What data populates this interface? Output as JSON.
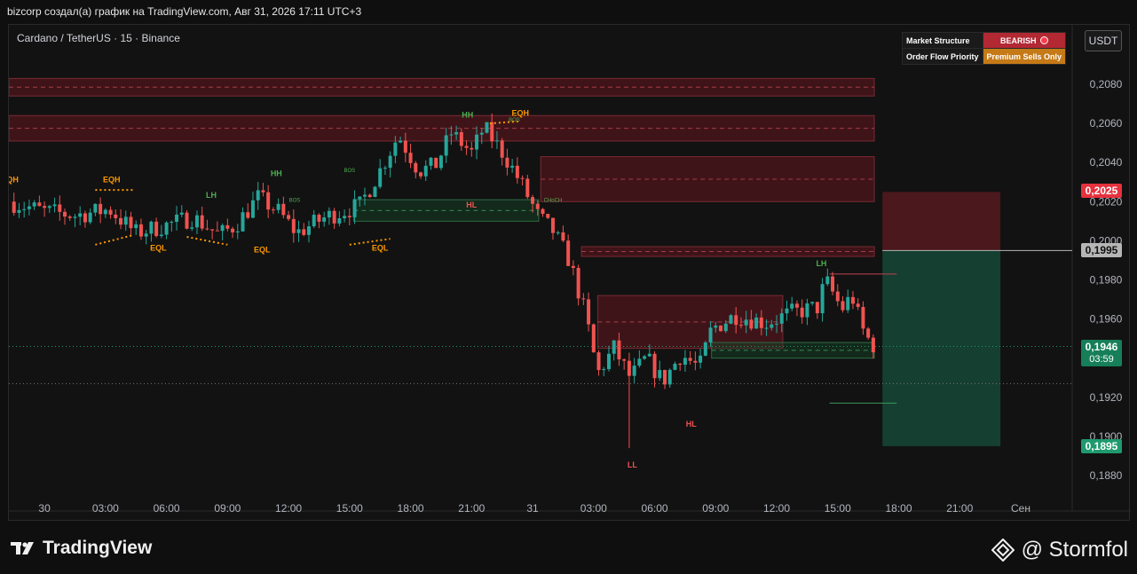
{
  "caption": "bizcorp создал(а) график на TradingView.com, Авг 31, 2026 17:11 UTC+3",
  "symbol_title": "Cardano / TetherUS · 15 · Binance",
  "status_panel": {
    "market_structure_label": "Market Structure",
    "market_structure_value": "BEARISH",
    "order_flow_label": "Order Flow Priority",
    "order_flow_value": "Premium Sells Only"
  },
  "currency_button": "USDT",
  "price_tags": {
    "red": "0,2025",
    "grey": "0,1995",
    "current": "0,1946",
    "countdown": "03:59",
    "green": "0,1895"
  },
  "footer": {
    "brand": "TradingView",
    "author": "@ Stormfol"
  },
  "colors": {
    "bull": "#26a69a",
    "bear": "#ef5350",
    "premium_zone": "#5c1a20",
    "discount_zone": "#123322",
    "label_orange": "#ff9800"
  },
  "chart_data": {
    "type": "candlestick",
    "title": "",
    "xlabel": "",
    "ylabel": "",
    "ylim": [
      0.187,
      0.21
    ],
    "y_ticks": [
      "0,2080",
      "0,2060",
      "0,2040",
      "0,2020",
      "0,2000",
      "0,1980",
      "0,1960",
      "0,1940",
      "0,1920",
      "0,1900",
      "0,1880"
    ],
    "y_tick_values": [
      0.208,
      0.206,
      0.204,
      0.202,
      0.2,
      0.198,
      0.196,
      0.194,
      0.192,
      0.19,
      0.188
    ],
    "x_ticks": [
      "30",
      "03:00",
      "06:00",
      "09:00",
      "12:00",
      "15:00",
      "18:00",
      "21:00",
      "31",
      "03:00",
      "06:00",
      "09:00",
      "12:00",
      "15:00",
      "18:00",
      "21:00",
      "Сен"
    ],
    "x_tick_hours": [
      0,
      3,
      6,
      9,
      12,
      15,
      18,
      21,
      24,
      27,
      30,
      33,
      36,
      39,
      42,
      45,
      48
    ],
    "x_range_hours": [
      -1.75,
      50.4
    ],
    "series": [
      {
        "candles_15m_close_path": [
          [
            -1.75,
            0.202
          ],
          [
            0,
            0.2015
          ],
          [
            1.5,
            0.2013
          ],
          [
            3.2,
            0.2016
          ],
          [
            4.5,
            0.2004
          ],
          [
            6.0,
            0.2008
          ],
          [
            7.3,
            0.2012
          ],
          [
            8.6,
            0.2003
          ],
          [
            9.4,
            0.2008
          ],
          [
            10.5,
            0.2022
          ],
          [
            11.5,
            0.2015
          ],
          [
            12.4,
            0.2004
          ],
          [
            13.8,
            0.2012
          ],
          [
            15.5,
            0.2018
          ],
          [
            16.5,
            0.2036
          ],
          [
            17.4,
            0.2054
          ],
          [
            18.4,
            0.2036
          ],
          [
            19.2,
            0.2038
          ],
          [
            20.0,
            0.2055
          ],
          [
            21.0,
            0.2045
          ],
          [
            21.6,
            0.2058
          ],
          [
            22.6,
            0.2044
          ],
          [
            23.4,
            0.203
          ],
          [
            24.3,
            0.2012
          ],
          [
            25.0,
            0.2005
          ],
          [
            25.8,
            0.199
          ],
          [
            26.6,
            0.1962
          ],
          [
            27.2,
            0.1932
          ],
          [
            28.0,
            0.1945
          ],
          [
            28.8,
            0.193
          ],
          [
            29.6,
            0.194
          ],
          [
            30.4,
            0.1928
          ],
          [
            31.3,
            0.1942
          ],
          [
            32.2,
            0.1935
          ],
          [
            32.8,
            0.1955
          ],
          [
            34.0,
            0.1962
          ],
          [
            35.5,
            0.1958
          ],
          [
            36.7,
            0.1963
          ],
          [
            38.0,
            0.1966
          ],
          [
            38.4,
            0.198
          ],
          [
            39.2,
            0.1965
          ],
          [
            39.7,
            0.1972
          ],
          [
            40.2,
            0.1955
          ],
          [
            40.6,
            0.1948
          ],
          [
            40.85,
            0.1946
          ]
        ],
        "wick_extremes": {
          "low_LL": 0.1894,
          "high_EQH": 0.2059
        }
      }
    ],
    "zones": [
      {
        "kind": "premium",
        "from_hour": -1.75,
        "to_hour": 40.8,
        "low": 0.2074,
        "high": 0.2083
      },
      {
        "kind": "premium",
        "from_hour": -1.75,
        "to_hour": 40.8,
        "low": 0.2051,
        "high": 0.2064
      },
      {
        "kind": "premium",
        "from_hour": 24.4,
        "to_hour": 40.8,
        "low": 0.202,
        "high": 0.2043
      },
      {
        "kind": "premium",
        "from_hour": 26.4,
        "to_hour": 40.8,
        "low": 0.1992,
        "high": 0.1997
      },
      {
        "kind": "premium",
        "from_hour": 27.2,
        "to_hour": 36.3,
        "low": 0.1945,
        "high": 0.1972
      },
      {
        "kind": "discount",
        "from_hour": 15.2,
        "to_hour": 24.3,
        "low": 0.201,
        "high": 0.2021
      },
      {
        "kind": "discount",
        "from_hour": 32.8,
        "to_hour": 40.8,
        "low": 0.194,
        "high": 0.1948
      }
    ],
    "position_box": {
      "from_hour": 41.2,
      "to_hour": 47.0,
      "entry": 0.1995,
      "stop": 0.2025,
      "target": 0.1895
    },
    "annotations": [
      {
        "text": "EQH",
        "x_hour": -1.7,
        "y": 0.203,
        "color": "orange"
      },
      {
        "text": "EQH",
        "x_hour": 3.3,
        "y": 0.203,
        "color": "orange"
      },
      {
        "text": "EQL",
        "x_hour": 5.6,
        "y": 0.1995,
        "color": "orange"
      },
      {
        "text": "LH",
        "x_hour": 8.2,
        "y": 0.2022,
        "color": "green"
      },
      {
        "text": "EQL",
        "x_hour": 10.7,
        "y": 0.1994,
        "color": "orange"
      },
      {
        "text": "HH",
        "x_hour": 11.4,
        "y": 0.2033,
        "color": "green"
      },
      {
        "text": "EQL",
        "x_hour": 16.5,
        "y": 0.1995,
        "color": "orange"
      },
      {
        "text": "HH",
        "x_hour": 20.8,
        "y": 0.2063,
        "color": "green"
      },
      {
        "text": "EQH",
        "x_hour": 23.4,
        "y": 0.2064,
        "color": "orange"
      },
      {
        "text": "HL",
        "x_hour": 21.0,
        "y": 0.2017,
        "color": "red"
      },
      {
        "text": "LL",
        "x_hour": 28.9,
        "y": 0.1884,
        "color": "red"
      },
      {
        "text": "HL",
        "x_hour": 31.8,
        "y": 0.1905,
        "color": "red"
      },
      {
        "text": "LH",
        "x_hour": 38.2,
        "y": 0.1987,
        "color": "green"
      }
    ],
    "small_annotations": [
      {
        "text": "BOS",
        "x_hour": 23.1,
        "y": 0.2061
      },
      {
        "text": "BOS",
        "x_hour": 15.0,
        "y": 0.2035
      },
      {
        "text": "BOS",
        "x_hour": 12.3,
        "y": 0.202
      },
      {
        "text": "CHoCH",
        "x_hour": 25.0,
        "y": 0.202
      }
    ],
    "current_price": 0.1946,
    "grid": false,
    "legend": "none"
  }
}
